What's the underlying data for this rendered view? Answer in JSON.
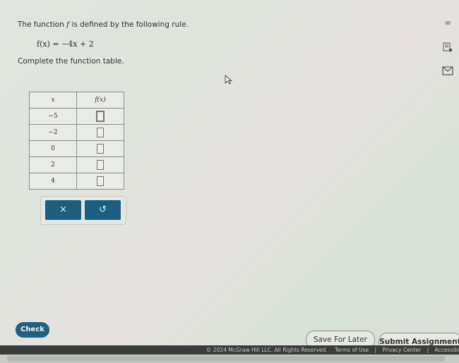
{
  "problem": {
    "prompt_before": "The function ",
    "prompt_var": "f",
    "prompt_after": " is defined by the following rule.",
    "rule": "f(x) = −4x + 2",
    "instruction": "Complete the function table."
  },
  "side_icons": [
    "glasses-icon",
    "notes-icon",
    "mail-icon"
  ],
  "table": {
    "headers": [
      "x",
      "f(x)"
    ],
    "rows": [
      {
        "x": "−5",
        "fx": ""
      },
      {
        "x": "−2",
        "fx": ""
      },
      {
        "x": "0",
        "fx": ""
      },
      {
        "x": "2",
        "fx": ""
      },
      {
        "x": "4",
        "fx": ""
      }
    ]
  },
  "keypad": {
    "clear_symbol": "×",
    "undo_symbol": "↺"
  },
  "actions": {
    "check": "Check",
    "save": "Save For Later",
    "submit": "Submit Assignment"
  },
  "footer": {
    "copyright": "© 2024 McGraw Hill LLC. All Rights Reserved.",
    "terms": "Terms of Use",
    "privacy": "Privacy Center",
    "accessibility": "Accessibility"
  },
  "colors": {
    "primary": "#1f627f",
    "footer_bg": "#3a3d3b"
  }
}
